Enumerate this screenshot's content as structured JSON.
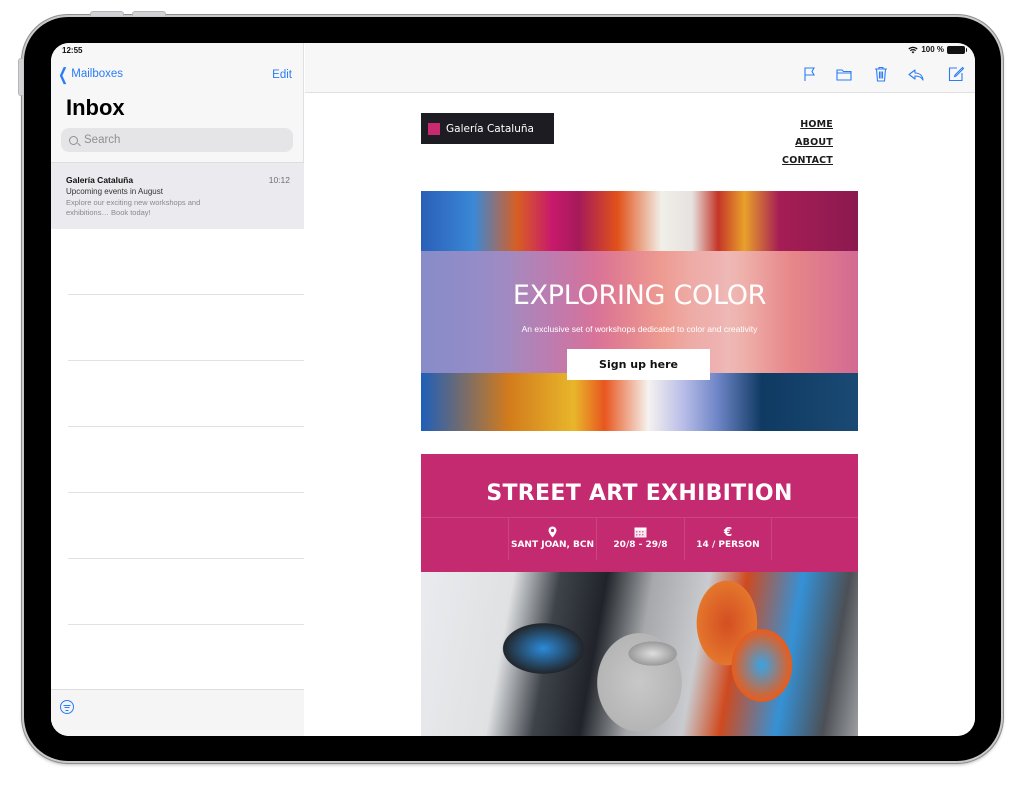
{
  "status_bar": {
    "time": "12:55",
    "battery": "100 %"
  },
  "sidebar": {
    "back_label": "Mailboxes",
    "edit_label": "Edit",
    "title": "Inbox",
    "search_placeholder": "Search",
    "messages": [
      {
        "sender": "Galería Cataluña",
        "time": "10:12",
        "subject": "Upcoming events in August",
        "preview": "Explore our exciting new workshops and exhibitions… Book today!"
      }
    ]
  },
  "toolbar": {
    "icons": [
      "flag-icon",
      "folder-icon",
      "trash-icon",
      "reply-icon",
      "compose-icon"
    ]
  },
  "email": {
    "brand_name": "Galería Cataluña",
    "brand_color": "#c8296f",
    "nav": [
      "HOME",
      "ABOUT",
      "CONTACT"
    ],
    "hero": {
      "title": "EXPLORING COLOR",
      "subtitle": "An exclusive set of workshops dedicated to color and creativity",
      "button_label": "Sign up here"
    },
    "exhibition": {
      "title": "STREET ART EXHIBITION",
      "accent_color": "#c42a6f",
      "location": "SANT JOAN, BCN",
      "dates": "20/8 - 29/8",
      "price": "14 / PERSON",
      "price_symbol": "€"
    }
  },
  "accent_color": "#2b7cf6"
}
